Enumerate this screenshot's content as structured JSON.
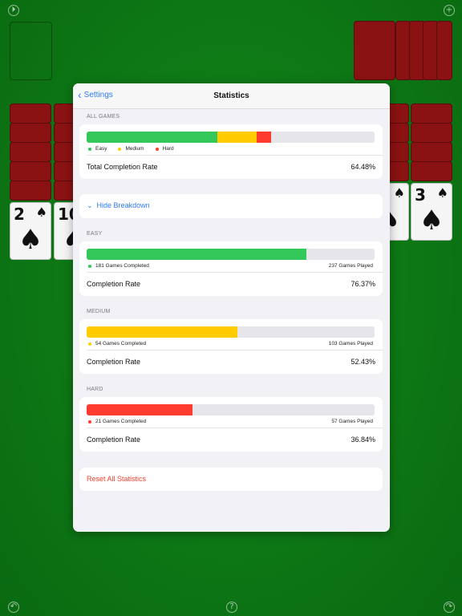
{
  "screen": {
    "icons": {
      "top_left": "rewind-icon",
      "top_right": "plus-icon",
      "bottom_left": "undo-icon",
      "bottom_center": "help-icon",
      "bottom_right": "redo-icon"
    }
  },
  "cards": {
    "left_face": {
      "rank": "2",
      "suit": "♠"
    },
    "left_face2": {
      "rank": "10",
      "suit": "♠"
    },
    "right_face": {
      "rank": "3",
      "suit": "♠"
    }
  },
  "sheet": {
    "nav": {
      "back_label": "Settings",
      "title": "Statistics"
    },
    "all_games": {
      "label": "ALL GAMES",
      "legend": [
        "Easy",
        "Medium",
        "Hard"
      ],
      "total_label": "Total Completion Rate",
      "total_value": "64.48%",
      "segments": {
        "easy": 0.455,
        "medium": 0.135,
        "hard": 0.052
      }
    },
    "breakdown": {
      "label": "Hide Breakdown"
    },
    "easy": {
      "label": "EASY",
      "completed": "181 Games Completed",
      "played": "237 Games Played",
      "rate_label": "Completion Rate",
      "rate_value": "76.37%",
      "fraction": 0.7637
    },
    "medium": {
      "label": "MEDIUM",
      "completed": "54 Games Completed",
      "played": "103 Games Played",
      "rate_label": "Completion Rate",
      "rate_value": "52.43%",
      "fraction": 0.5243
    },
    "hard": {
      "label": "HARD",
      "completed": "21 Games Completed",
      "played": "57 Games Played",
      "rate_label": "Completion Rate",
      "rate_value": "36.84%",
      "fraction": 0.3684
    },
    "reset": {
      "label": "Reset All Statistics"
    }
  },
  "colors": {
    "easy": "#34c759",
    "medium": "#ffcc00",
    "hard": "#ff3b30",
    "accent": "#2f7cf6",
    "felt": "#0e7a16",
    "card_back": "#8b1212"
  }
}
